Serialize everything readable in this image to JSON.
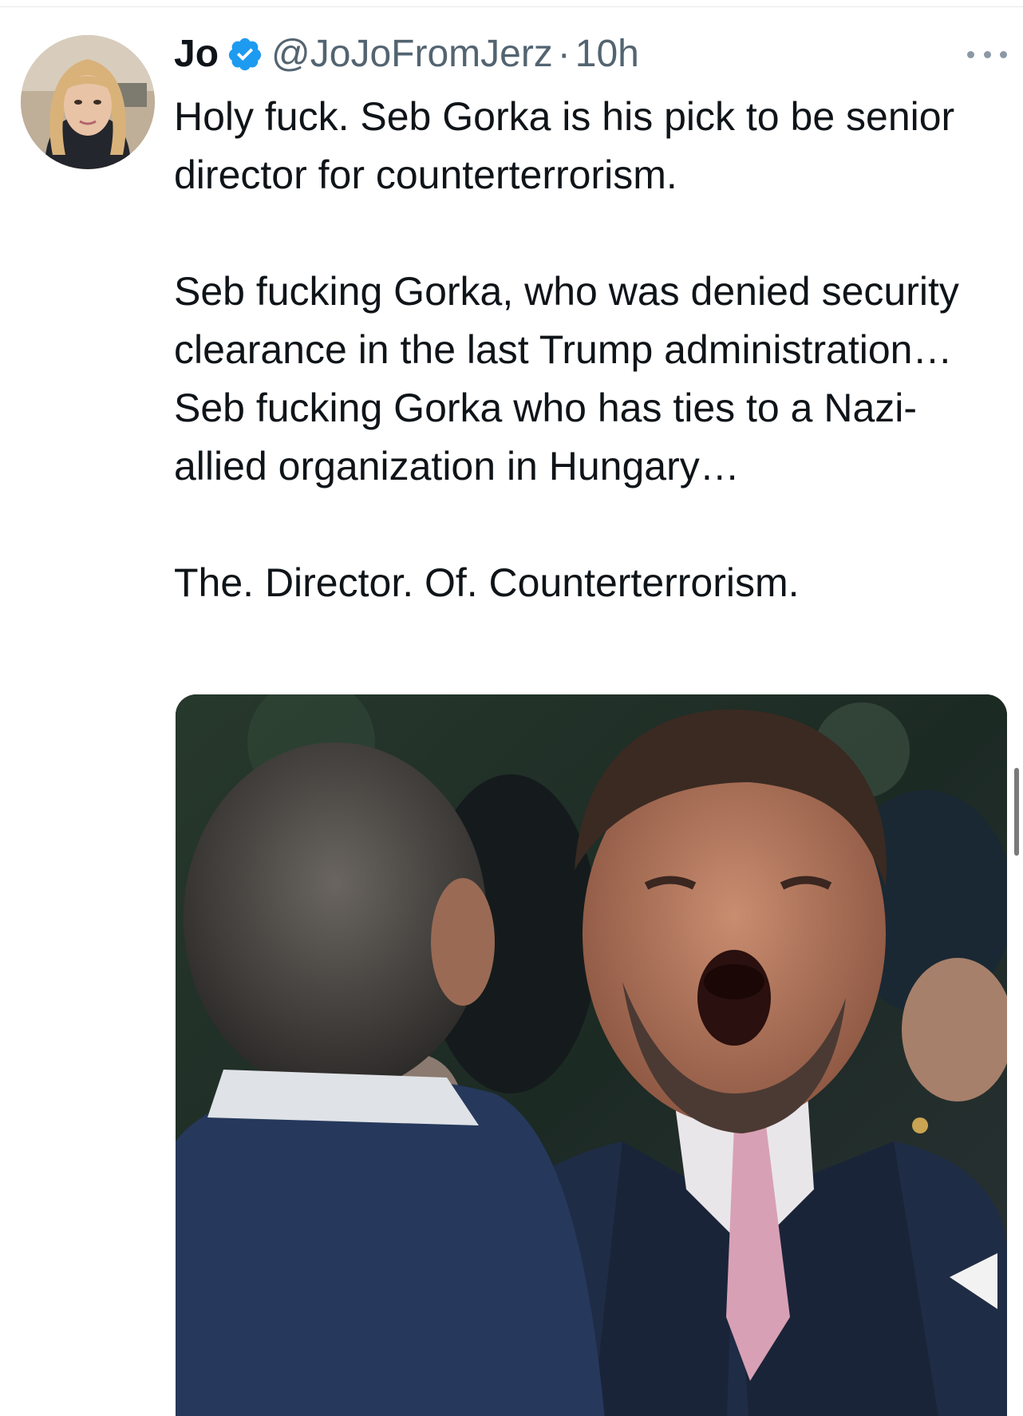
{
  "tweet": {
    "author": {
      "display_name": "Jo",
      "handle": "@JoJoFromJerz",
      "verified": true,
      "avatar_icon": "profile-photo"
    },
    "separator": "·",
    "timestamp": "10h",
    "more_icon": "more-horizontal-icon",
    "text_paragraphs": [
      "Holy fuck. Seb Gorka is his pick to be senior director for counterterrorism.",
      "Seb fucking Gorka, who was denied security clearance in the last Trump administration… Seb fucking Gorka who has ties to a Nazi-allied organization in Hungary…",
      "The. Director. Of. Counterterrorism."
    ],
    "media": {
      "type": "photo"
    }
  },
  "colors": {
    "text": "#0f1419",
    "secondary": "#536471",
    "verified_blue": "#1d9bf0",
    "divider": "#e6e9ec"
  }
}
